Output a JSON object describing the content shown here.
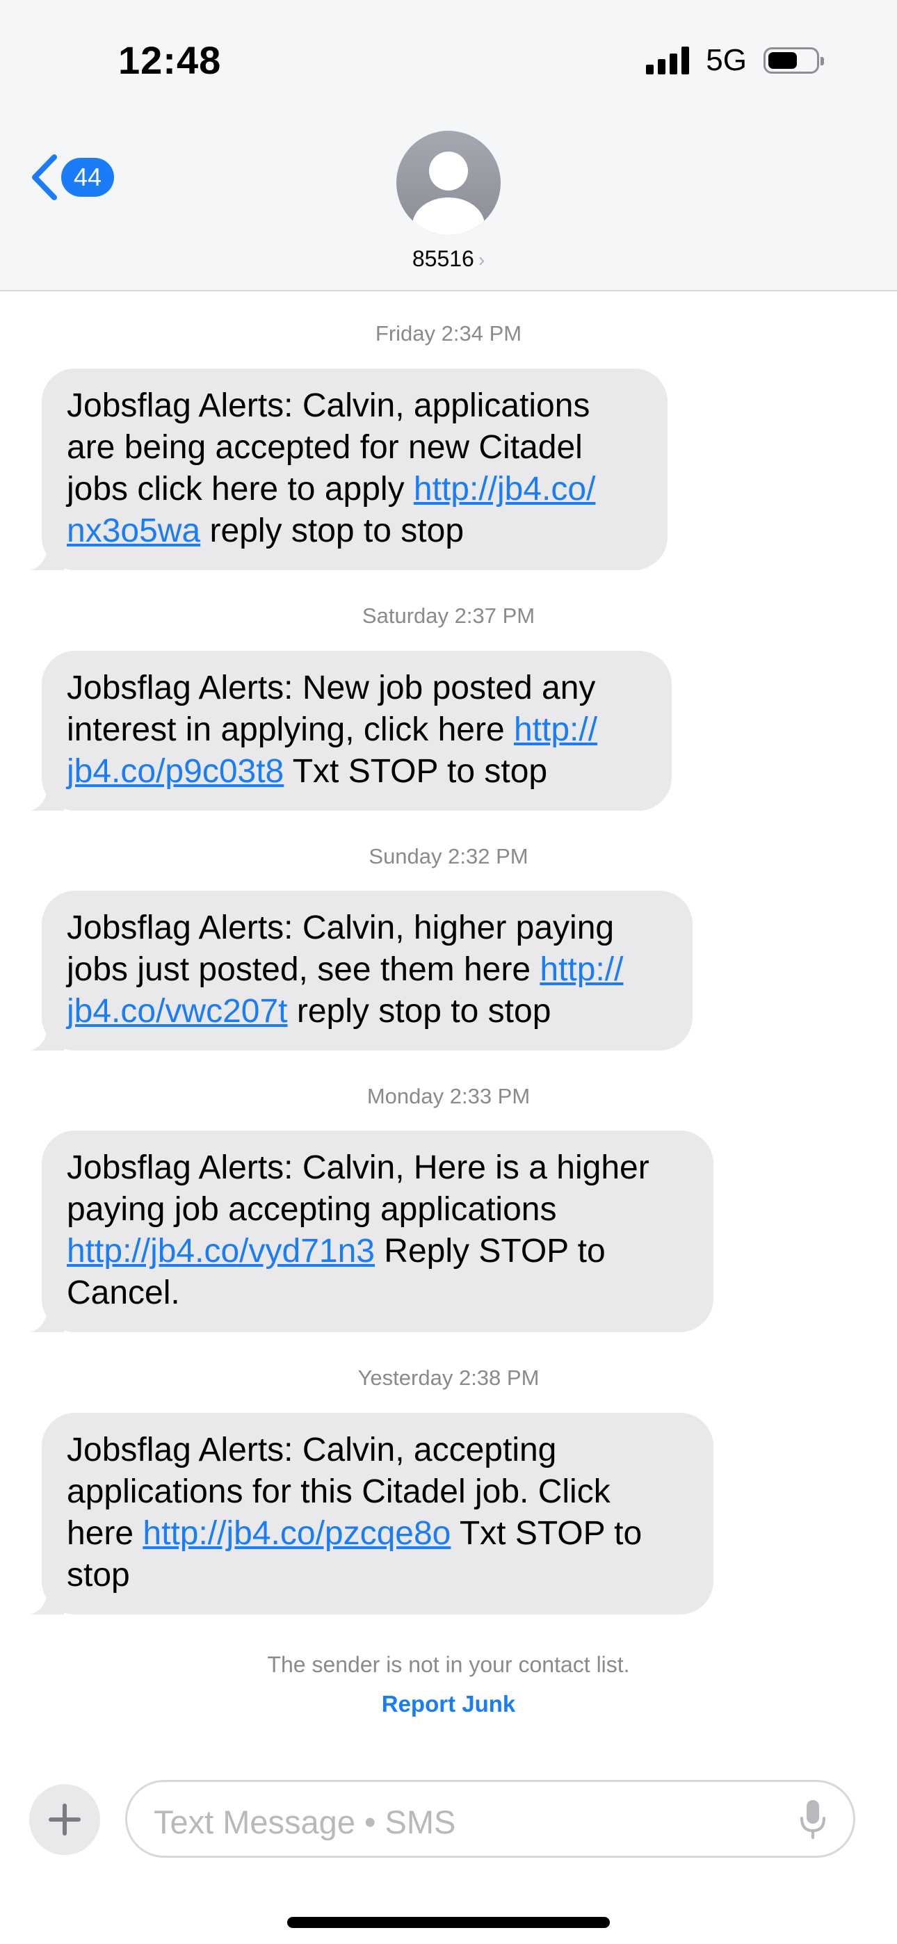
{
  "status_bar": {
    "time": "12:48",
    "network": "5G",
    "battery_percent": 62
  },
  "header": {
    "back_count": "44",
    "contact_name": "85516",
    "contact_chevron": "›"
  },
  "thread": [
    {
      "timestamp": {
        "day": "Friday",
        "time": "2:34 PM"
      },
      "message": {
        "lines": [
          [
            {
              "text": "Jobsflag Alerts: Calvin, applications"
            }
          ],
          [
            {
              "text": "are being accepted for new Citadel"
            }
          ],
          [
            {
              "text": "jobs click here to apply "
            },
            {
              "text": "http://jb4.co/",
              "link": true
            }
          ],
          [
            {
              "text": "nx3o5wa",
              "link": true
            },
            {
              "text": " reply stop to stop"
            }
          ]
        ]
      }
    },
    {
      "timestamp": {
        "day": "Saturday",
        "time": "2:37 PM"
      },
      "message": {
        "lines": [
          [
            {
              "text": "Jobsflag Alerts: New job posted any"
            }
          ],
          [
            {
              "text": "interest in applying, click here "
            },
            {
              "text": "http://",
              "link": true
            }
          ],
          [
            {
              "text": "jb4.co/p9c03t8",
              "link": true
            },
            {
              "text": " Txt STOP to stop"
            }
          ]
        ]
      }
    },
    {
      "timestamp": {
        "day": "Sunday",
        "time": "2:32 PM"
      },
      "message": {
        "lines": [
          [
            {
              "text": "Jobsflag Alerts: Calvin, higher paying"
            }
          ],
          [
            {
              "text": "jobs just posted, see them here "
            },
            {
              "text": "http://",
              "link": true
            }
          ],
          [
            {
              "text": "jb4.co/vwc207t",
              "link": true
            },
            {
              "text": " reply stop to stop"
            }
          ]
        ]
      }
    },
    {
      "timestamp": {
        "day": "Monday",
        "time": "2:33 PM"
      },
      "message": {
        "lines": [
          [
            {
              "text": "Jobsflag Alerts: Calvin, Here is a higher"
            }
          ],
          [
            {
              "text": "paying job accepting applications"
            }
          ],
          [
            {
              "text": "http://jb4.co/vyd71n3",
              "link": true
            },
            {
              "text": " Reply STOP to"
            }
          ],
          [
            {
              "text": "Cancel."
            }
          ]
        ]
      }
    },
    {
      "timestamp": {
        "day": "Yesterday",
        "time": "2:38 PM"
      },
      "message": {
        "lines": [
          [
            {
              "text": "Jobsflag Alerts: Calvin, accepting"
            }
          ],
          [
            {
              "text": "applications for this Citadel job. Click"
            }
          ],
          [
            {
              "text": "here "
            },
            {
              "text": "http://jb4.co/pzcqe8o",
              "link": true
            },
            {
              "text": " Txt STOP to"
            }
          ],
          [
            {
              "text": "stop"
            }
          ]
        ]
      }
    }
  ],
  "footer": {
    "notice": "The sender is not in your contact list.",
    "report_junk": "Report Junk"
  },
  "composer": {
    "placeholder": "Text Message • SMS"
  },
  "icons": {
    "back": "chevron-left-icon",
    "avatar": "person-icon",
    "add": "plus-icon",
    "dictate": "microphone-icon"
  },
  "colors": {
    "accent": "#1a7cf7",
    "bubble": "#e9e9eb",
    "meta_text": "#8a8a8e"
  }
}
